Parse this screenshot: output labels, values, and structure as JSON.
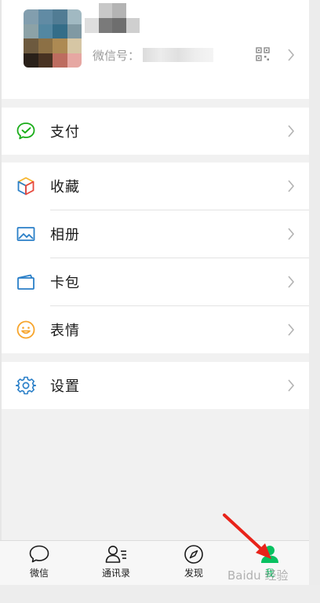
{
  "profile": {
    "wechat_id_label": "微信号：",
    "avatar_icon": "blurred-avatar",
    "qr_icon": "qr-code-icon"
  },
  "menu": {
    "pay": {
      "label": "支付",
      "icon": "pay-icon"
    },
    "favorites": {
      "label": "收藏",
      "icon": "favorites-cube-icon"
    },
    "album": {
      "label": "相册",
      "icon": "album-image-icon"
    },
    "cards": {
      "label": "卡包",
      "icon": "wallet-card-icon"
    },
    "stickers": {
      "label": "表情",
      "icon": "smiley-icon"
    },
    "settings": {
      "label": "设置",
      "icon": "gear-icon"
    }
  },
  "tabbar": {
    "chats": {
      "label": "微信",
      "icon": "chat-bubble-icon"
    },
    "contacts": {
      "label": "通讯录",
      "icon": "contacts-icon"
    },
    "discover": {
      "label": "发现",
      "icon": "compass-icon"
    },
    "me": {
      "label": "我",
      "icon": "person-icon"
    }
  },
  "annotation": {
    "arrow_color": "#e8231a",
    "watermark": "Baidu 经验"
  },
  "colors": {
    "accent_green": "#07c160",
    "icon_blue": "#2a7fc8",
    "background": "#efefef"
  }
}
